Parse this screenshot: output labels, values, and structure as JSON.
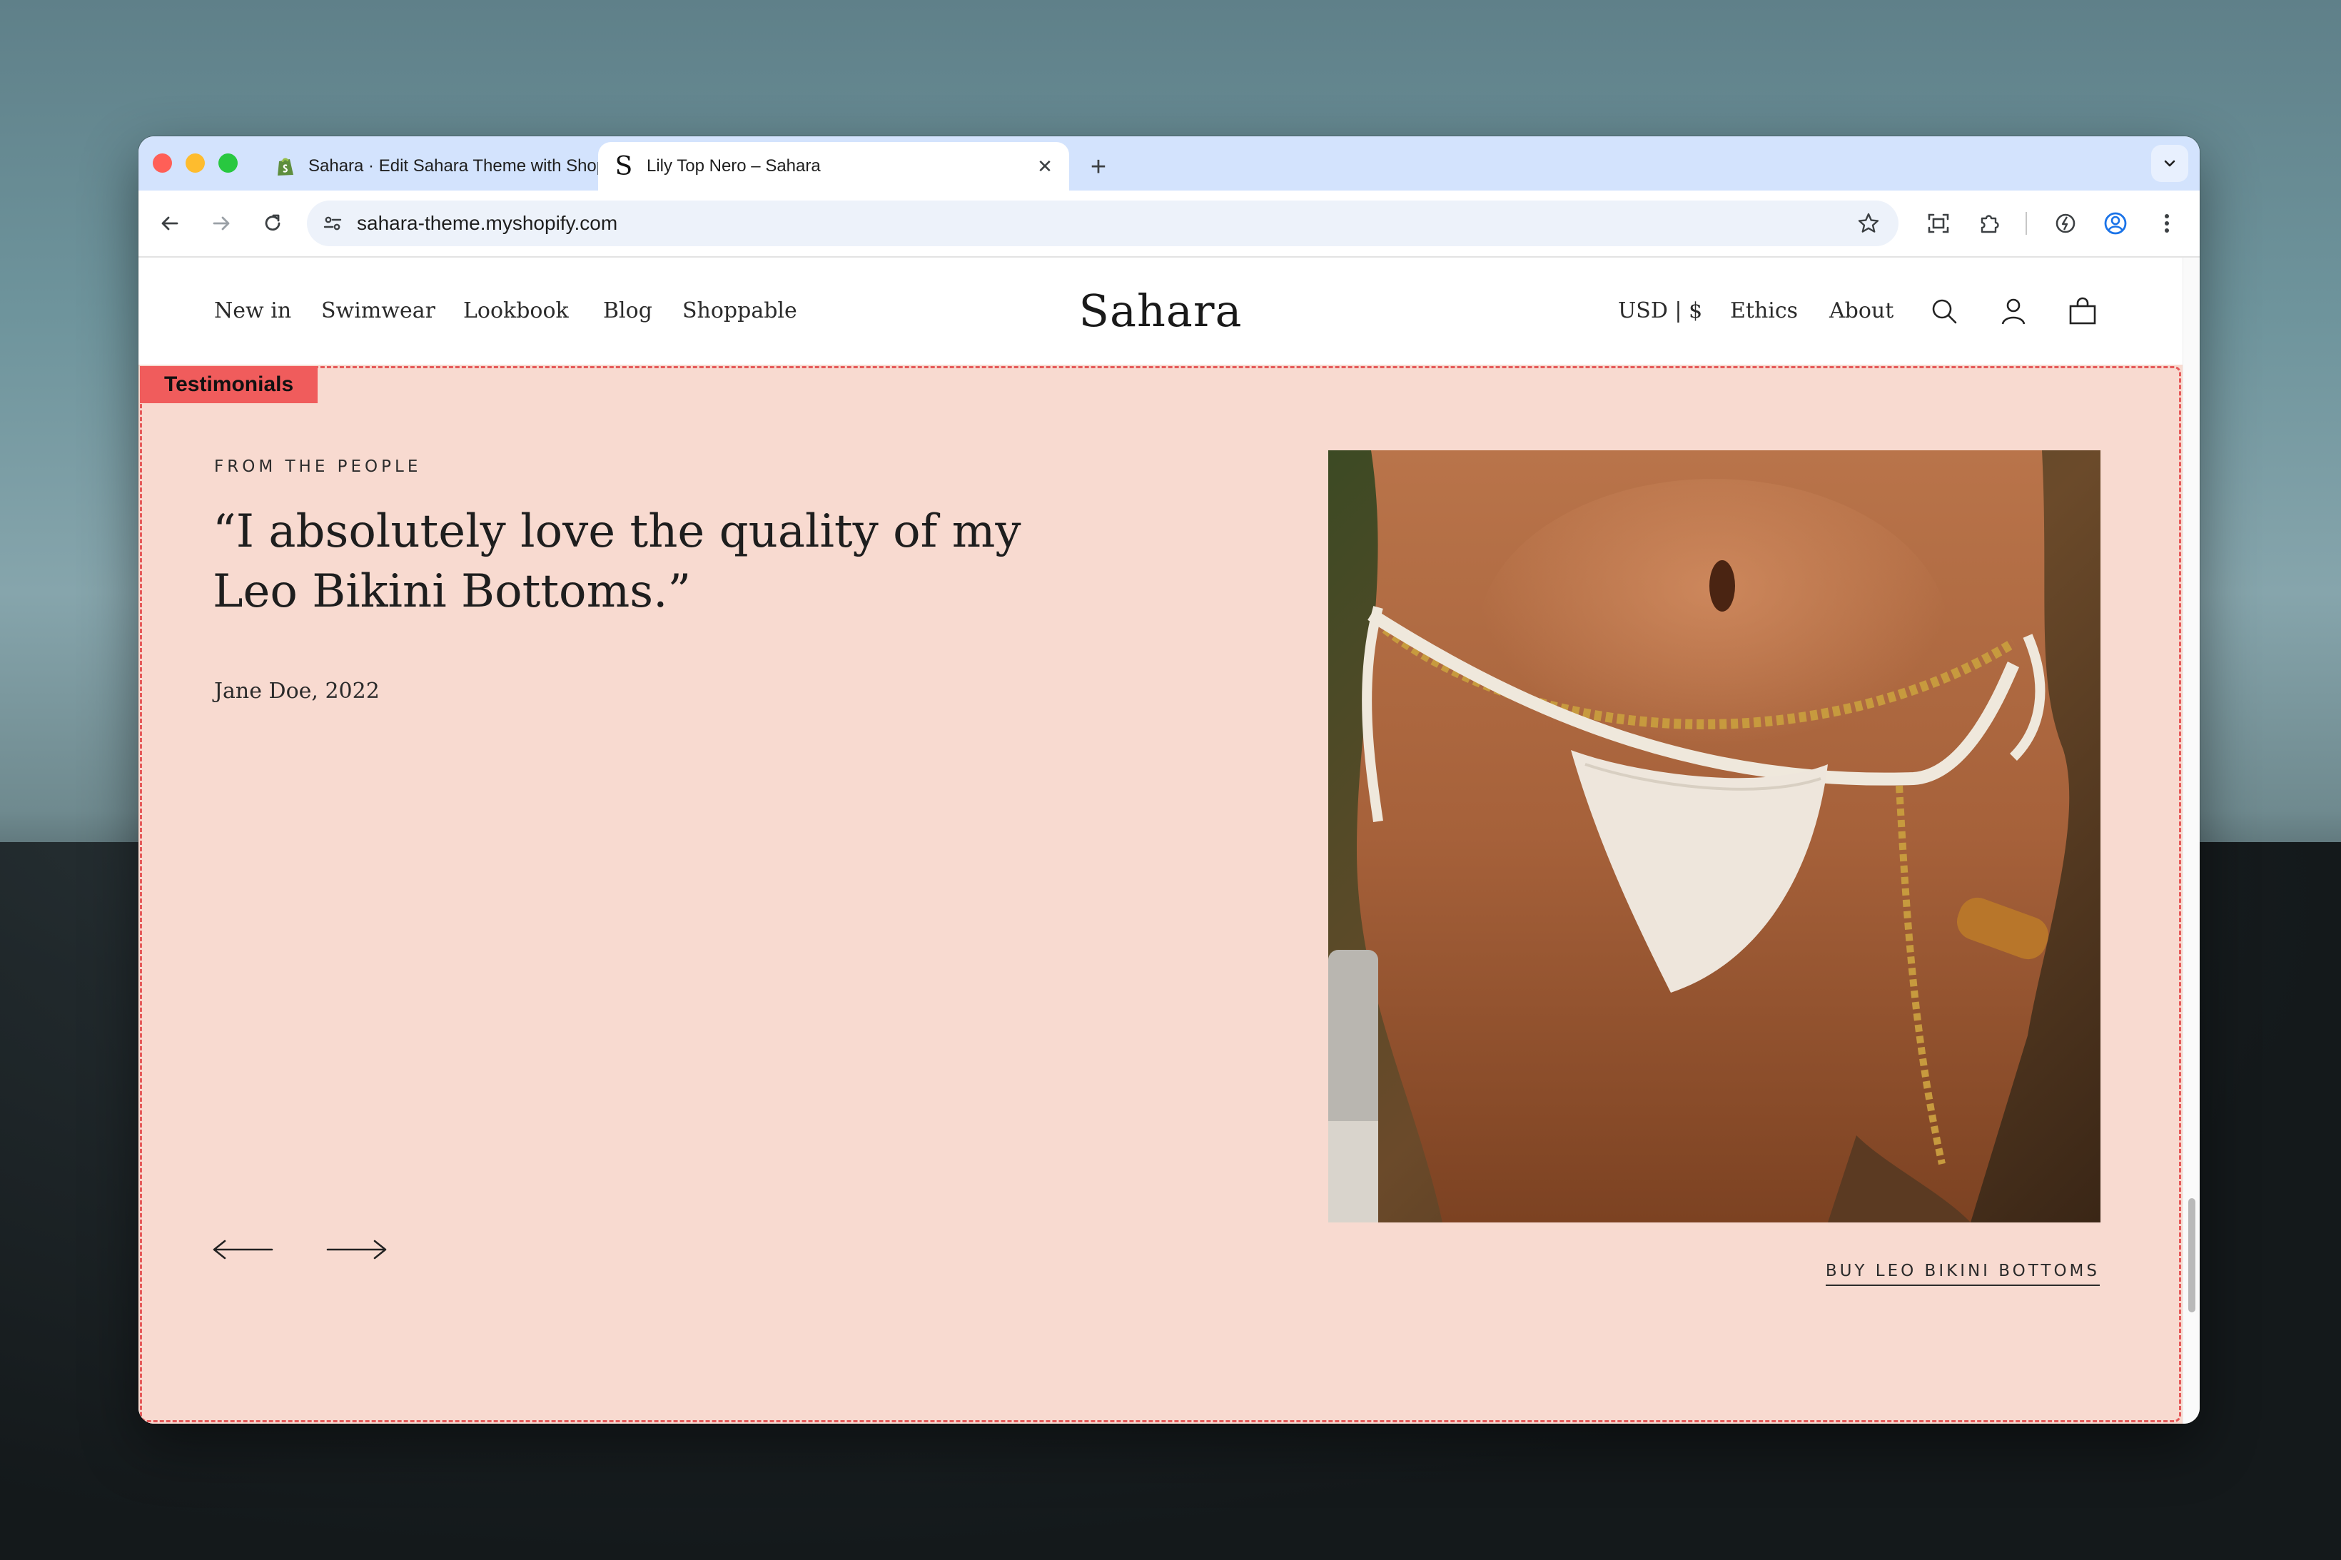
{
  "browser": {
    "tabs": [
      {
        "title": "Sahara · Edit Sahara Theme with Shopify",
        "favicon": "shopify-icon",
        "active": false
      },
      {
        "title": "Lily Top Nero – Sahara",
        "favicon": "sahara-s-icon",
        "active": true
      }
    ],
    "new_tab_label": "+",
    "close_glyph": "✕",
    "url": "sahara-theme.myshopify.com"
  },
  "site": {
    "nav_left": [
      "New in",
      "Swimwear",
      "Lookbook",
      "Blog",
      "Shoppable"
    ],
    "brand": "Sahara",
    "currency": "USD | $",
    "nav_right": [
      "Ethics",
      "About"
    ],
    "icons": [
      "search-icon",
      "account-icon",
      "bag-icon"
    ]
  },
  "editor": {
    "section_tag": "Testimonials",
    "outline_color": "#e55a5a"
  },
  "testimonial": {
    "eyebrow": "FROM THE PEOPLE",
    "quote": "“I absolutely love the quality of my Leo Bikini Bottoms.”",
    "author": "Jane Doe, 2022",
    "cta": "BUY LEO BIKINI BOTTOMS",
    "background_color": "#f8dad0"
  }
}
